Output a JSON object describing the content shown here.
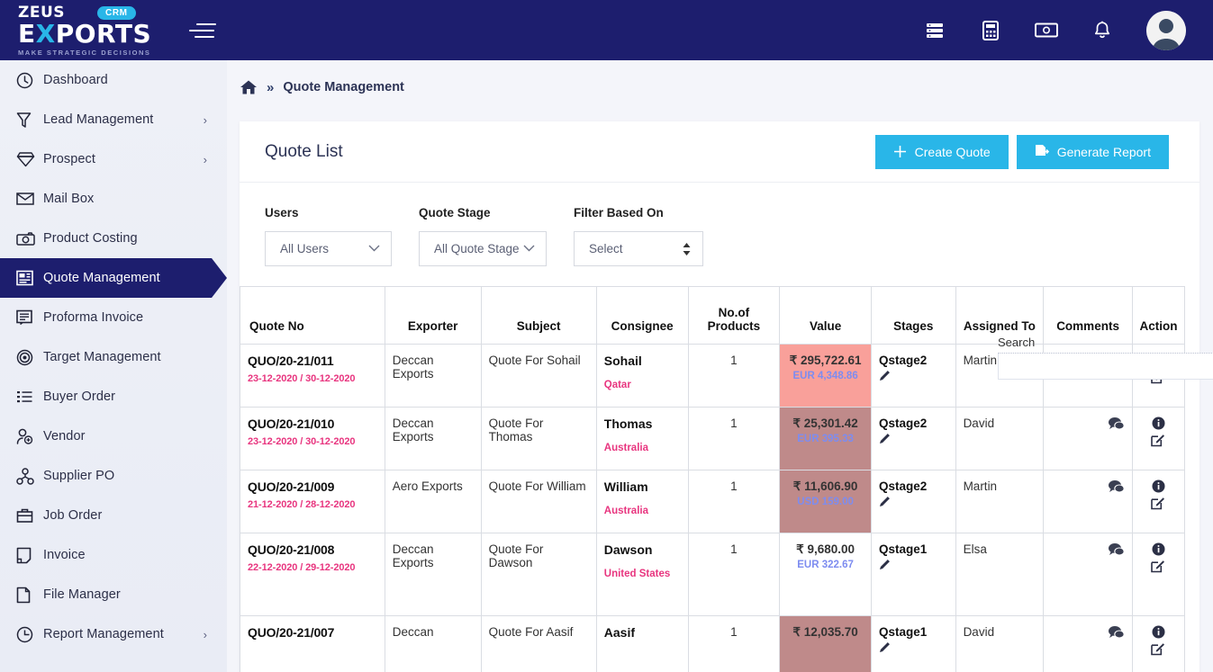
{
  "brand": {
    "zeus": "ZEUS",
    "badge": "CRM",
    "exports_pre": "E",
    "exports_x": "X",
    "exports_post": "PORTS",
    "tagline": "MAKE STRATEGIC DECISIONS"
  },
  "topbar": {
    "icons": [
      "server-icon",
      "calculator-icon",
      "money-icon",
      "bell-icon"
    ],
    "avatar": "user-avatar"
  },
  "sidebar": {
    "items": [
      {
        "label": "Dashboard",
        "icon": "dashboard-icon",
        "chevron": "",
        "active": false
      },
      {
        "label": "Lead Management",
        "icon": "funnel-icon",
        "chevron": "›",
        "active": false
      },
      {
        "label": "Prospect",
        "icon": "diamond-icon",
        "chevron": "›",
        "active": false
      },
      {
        "label": "Mail Box",
        "icon": "mail-icon",
        "chevron": "",
        "active": false
      },
      {
        "label": "Product Costing",
        "icon": "camera-icon",
        "chevron": "",
        "active": false
      },
      {
        "label": "Quote Management",
        "icon": "quote-icon",
        "chevron": "",
        "active": true
      },
      {
        "label": "Proforma Invoice",
        "icon": "document-lines-icon",
        "chevron": "",
        "active": false
      },
      {
        "label": "Target Management",
        "icon": "target-icon",
        "chevron": "",
        "active": false
      },
      {
        "label": "Buyer Order",
        "icon": "list-icon",
        "chevron": "",
        "active": false
      },
      {
        "label": "Vendor",
        "icon": "user-plus-icon",
        "chevron": "",
        "active": false
      },
      {
        "label": "Supplier PO",
        "icon": "network-icon",
        "chevron": "",
        "active": false
      },
      {
        "label": "Job Order",
        "icon": "briefcase-icon",
        "chevron": "",
        "active": false
      },
      {
        "label": "Invoice",
        "icon": "page-icon",
        "chevron": "",
        "active": false
      },
      {
        "label": "File Manager",
        "icon": "file-icon",
        "chevron": "",
        "active": false
      },
      {
        "label": "Report Management",
        "icon": "clock-icon",
        "chevron": "›",
        "active": false
      }
    ]
  },
  "breadcrumb": {
    "home_icon": "home-icon",
    "separator": "»",
    "current": "Quote Management"
  },
  "card": {
    "title": "Quote List",
    "create_button": "Create Quote",
    "report_button": "Generate Report"
  },
  "filters": [
    {
      "label": "Users",
      "value": "All Users",
      "control": "dropdown"
    },
    {
      "label": "Quote Stage",
      "value": "All Quote Stage",
      "control": "dropdown"
    },
    {
      "label": "Filter Based On",
      "value": "Select",
      "control": "select"
    }
  ],
  "search": {
    "label": "Search",
    "value": "",
    "placeholder": ""
  },
  "table": {
    "columns": [
      "Quote No",
      "Exporter",
      "Subject",
      "Consignee",
      "No.of Products",
      "Value",
      "Stages",
      "Assigned To",
      "Comments",
      "Action"
    ],
    "rows": [
      {
        "quote_no": "QUO/20-21/011",
        "dates": "23-12-2020 / 30-12-2020",
        "exporter": "Deccan Exports",
        "subject": "Quote For Sohail",
        "consignee": "Sohail",
        "country": "Qatar",
        "products": "1",
        "value_main": "₹ 295,722.61",
        "value_sub": "EUR 4,348.86",
        "value_bg": "#f9a09a",
        "stage": "Qstage2",
        "assigned_to": "Martin",
        "comments_icon": "comments-icon",
        "info_icon": "info-icon",
        "edit_icon": "edit-icon"
      },
      {
        "quote_no": "QUO/20-21/010",
        "dates": "23-12-2020 / 30-12-2020",
        "exporter": "Deccan Exports",
        "subject": "Quote For Thomas",
        "consignee": "Thomas",
        "country": "Australia",
        "products": "1",
        "value_main": "₹ 25,301.42",
        "value_sub": "EUR 395.33",
        "value_bg": "#bf8a8a",
        "stage": "Qstage2",
        "assigned_to": "David",
        "comments_icon": "comments-icon",
        "info_icon": "info-icon",
        "edit_icon": "edit-icon"
      },
      {
        "quote_no": "QUO/20-21/009",
        "dates": "21-12-2020 / 28-12-2020",
        "exporter": "Aero Exports",
        "subject": "Quote For William",
        "consignee": "William",
        "country": "Australia",
        "products": "1",
        "value_main": "₹ 11,606.90",
        "value_sub": "USD 159.00",
        "value_bg": "#bf8a8a",
        "stage": "Qstage2",
        "assigned_to": "Martin",
        "comments_icon": "comments-icon",
        "info_icon": "info-icon",
        "edit_icon": "edit-icon"
      },
      {
        "quote_no": "QUO/20-21/008",
        "dates": "22-12-2020 / 29-12-2020",
        "exporter": "Deccan Exports",
        "subject": "Quote For Dawson",
        "consignee": "Dawson",
        "country": "United States",
        "products": "1",
        "value_main": "₹ 9,680.00",
        "value_sub": "EUR 322.67",
        "value_bg": "#ffffff",
        "stage": "Qstage1",
        "assigned_to": "Elsa",
        "comments_icon": "comments-icon",
        "info_icon": "info-icon",
        "edit_icon": "edit-icon"
      },
      {
        "quote_no": "QUO/20-21/007",
        "dates": "",
        "exporter": "Deccan",
        "subject": "Quote For Aasif",
        "consignee": "Aasif",
        "country": "",
        "products": "1",
        "value_main": "₹ 12,035.70",
        "value_sub": "",
        "value_bg": "#bf8a8a",
        "stage": "Qstage1",
        "assigned_to": "David",
        "comments_icon": "comments-icon",
        "info_icon": "info-icon",
        "edit_icon": "edit-icon"
      }
    ]
  },
  "colors": {
    "navy": "#1d1e6e",
    "cyan": "#29b6e8",
    "pink": "#e8357f",
    "sidebar_bg": "#eef0f7",
    "page_bg": "#f4f5fa"
  }
}
